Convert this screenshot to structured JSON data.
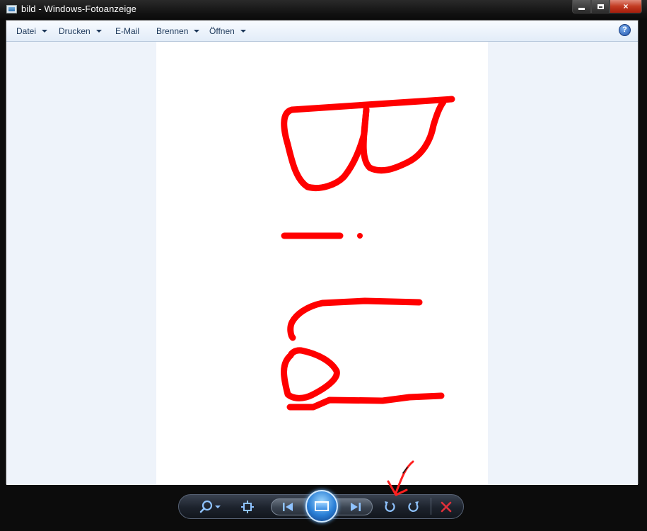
{
  "window": {
    "title": "bild - Windows-Fotoanzeige",
    "icon": "photo-viewer-icon",
    "buttons": {
      "minimize": "minimize-icon",
      "maximize": "maximize-icon",
      "close": "×"
    }
  },
  "menu": {
    "items": [
      {
        "label": "Datei",
        "dropdown": true
      },
      {
        "label": "Drucken",
        "dropdown": true
      },
      {
        "label": "E-Mail",
        "dropdown": false
      },
      {
        "label": "Brennen",
        "dropdown": true
      },
      {
        "label": "Öffnen",
        "dropdown": true
      }
    ],
    "help": "?"
  },
  "controls": {
    "zoom": "zoom-icon",
    "actual_size": "actual-size-icon",
    "previous": "previous-icon",
    "slideshow": "slideshow-icon",
    "next": "next-icon",
    "rotate_left": "rotate-counterclockwise-icon",
    "rotate_right": "rotate-clockwise-icon",
    "delete": "delete-icon"
  },
  "colors": {
    "ink": "#ff0000",
    "control_glyph": "#8fc3ff",
    "delete_glyph": "#e0303a",
    "paper": "#ffffff",
    "viewer_bg": "#eef3fa"
  }
}
